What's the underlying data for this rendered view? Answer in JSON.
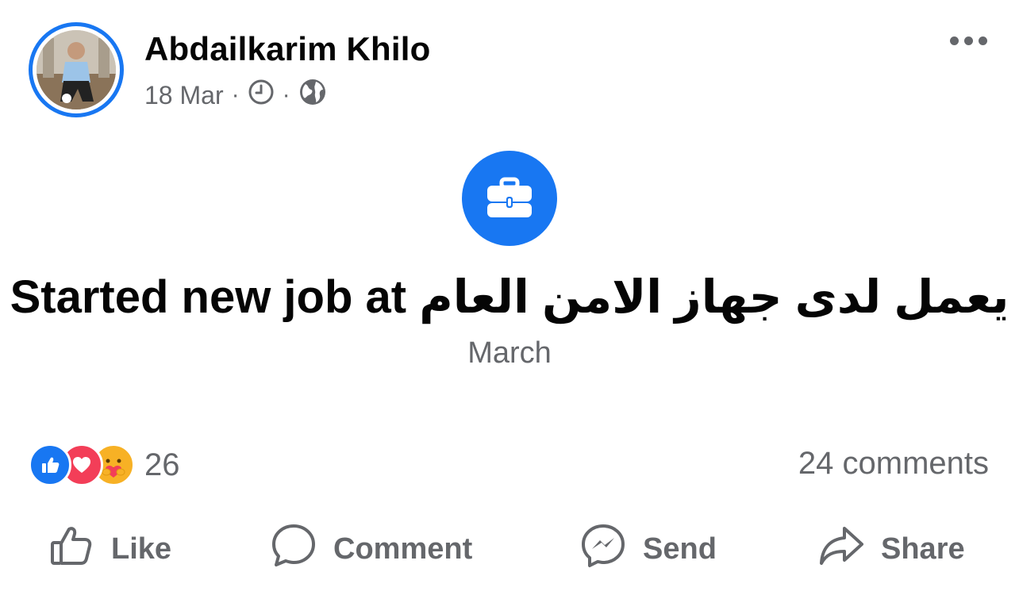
{
  "post": {
    "author": "Abdailkarim Khilo",
    "date": "18 Mar",
    "separator": "·",
    "event_title": "Started new job at يعمل لدى جهاز الامن العام",
    "event_subtitle": "March"
  },
  "engagement": {
    "reaction_count": "26",
    "comments_label": "24 comments",
    "reactions": [
      "like",
      "love",
      "care"
    ]
  },
  "actions": {
    "like": "Like",
    "comment": "Comment",
    "send": "Send",
    "share": "Share"
  },
  "colors": {
    "accent": "#1877f2",
    "secondary_text": "#65676b",
    "love": "#f33e58",
    "care": "#f7b125"
  },
  "icons": {
    "event": "briefcase-icon",
    "time": "clock-icon",
    "audience": "globe-icon",
    "more": "more-dots-icon"
  }
}
